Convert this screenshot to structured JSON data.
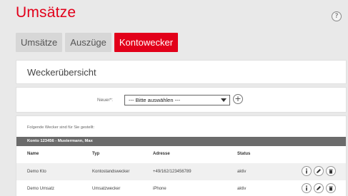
{
  "page": {
    "title": "Umsätze",
    "help_label": "?"
  },
  "tabs": [
    {
      "label": "Umsätze",
      "active": false
    },
    {
      "label": "Auszüge",
      "active": false
    },
    {
      "label": "Kontowecker",
      "active": true
    }
  ],
  "overview": {
    "heading": "Weckerübersicht"
  },
  "new_alarm": {
    "label": "Neuer*:",
    "selected": "--- Bitte auswählen ---",
    "add_label": "+"
  },
  "list": {
    "intro": "Folgende Wecker sind für Sie gestellt:",
    "account": "Konto 123456 - Mustermann, Max",
    "columns": [
      "Name",
      "Typ",
      "Adresse",
      "Status"
    ],
    "rows": [
      {
        "name": "Demo Kto",
        "typ": "Kontostandswecker",
        "adresse": "+49/162/123456789",
        "status": "aktiv"
      },
      {
        "name": "Demo Umsatz",
        "typ": "Umsatzwecker",
        "adresse": "iPhone",
        "status": "aktiv"
      }
    ]
  },
  "colors": {
    "accent": "#e2001a",
    "account_header": "#6b6b6b"
  },
  "icons": [
    "help-icon",
    "chevron-down-icon",
    "plus-icon",
    "info-icon",
    "pencil-icon",
    "trash-icon"
  ]
}
